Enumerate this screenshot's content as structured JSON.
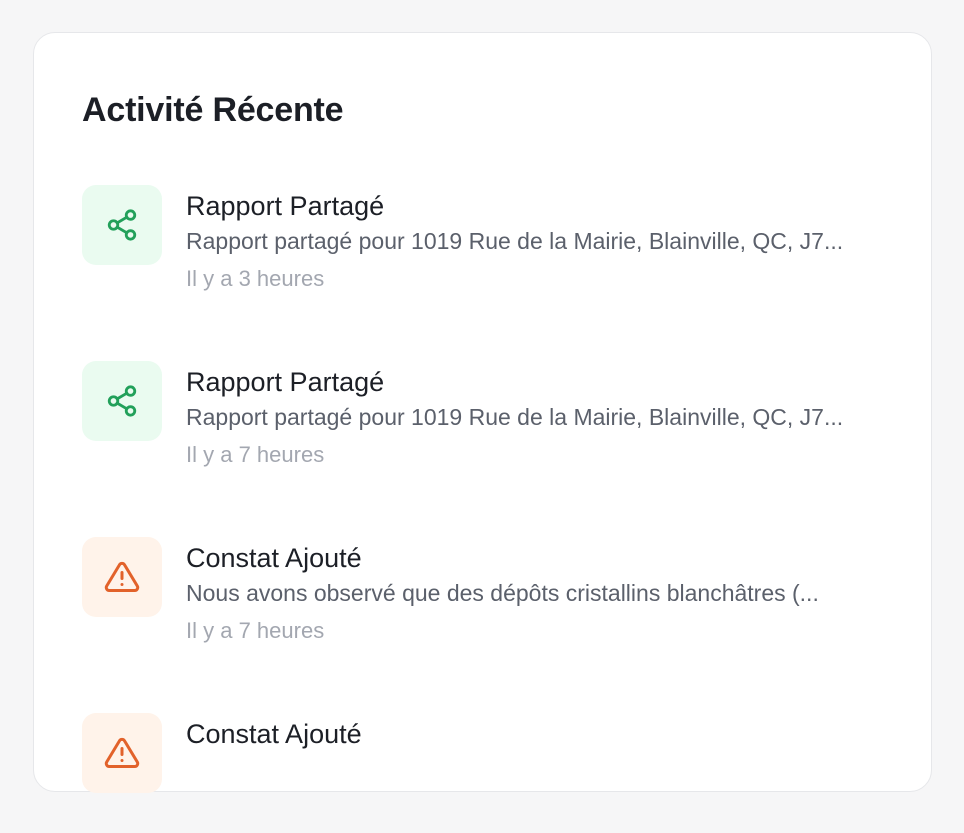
{
  "section": {
    "title": "Activité Récente"
  },
  "activities": [
    {
      "icon": "share-icon",
      "tone": "green",
      "title": "Rapport Partagé",
      "description": "Rapport partagé pour 1019 Rue de la Mairie, Blainville, QC, J7...",
      "time": "Il y a 3 heures"
    },
    {
      "icon": "share-icon",
      "tone": "green",
      "title": "Rapport Partagé",
      "description": "Rapport partagé pour 1019 Rue de la Mairie, Blainville, QC, J7...",
      "time": "Il y a 7 heures"
    },
    {
      "icon": "warning-icon",
      "tone": "orange",
      "title": "Constat Ajouté",
      "description": "Nous avons observé que des dépôts cristallins blanchâtres (...",
      "time": "Il y a 7 heures"
    },
    {
      "icon": "warning-icon",
      "tone": "orange",
      "title": "Constat Ajouté",
      "description": "",
      "time": ""
    }
  ],
  "colors": {
    "share_icon": "#22a05a",
    "share_bg": "#eafbf0",
    "warning_icon": "#e2622b",
    "warning_bg": "#fff3ea"
  }
}
